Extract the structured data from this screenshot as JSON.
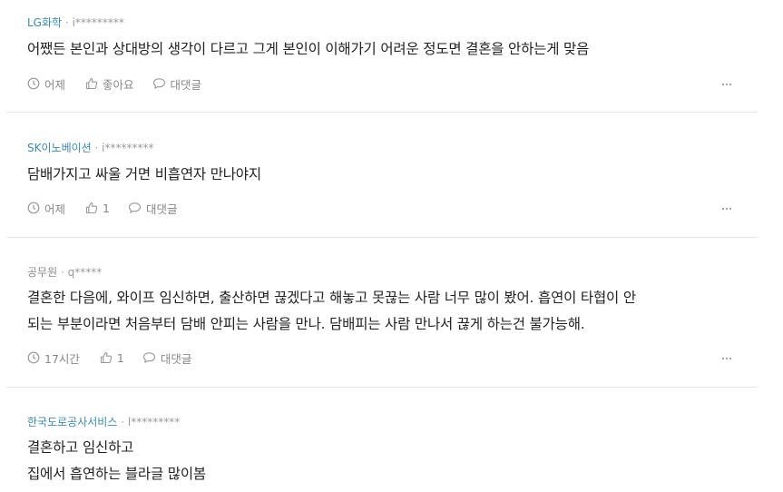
{
  "comments": [
    {
      "company": "LG화학",
      "user": "i*********",
      "lines": [
        "어쨌든 본인과 상대방의 생각이 다르고 그게 본인이 이해가기 어려운 정도면 결혼을 안하는게 맞음"
      ],
      "time": "어제",
      "like": "좋아요",
      "reply": "대댓글"
    },
    {
      "company": "SK이노베이션",
      "user": "i*********",
      "lines": [
        "담배가지고 싸울 거면 비흡연자 만나야지"
      ],
      "time": "어제",
      "like": "1",
      "reply": "대댓글"
    },
    {
      "company": "공무원",
      "user": "q*****",
      "lines": [
        "결혼한 다음에, 와이프 임신하면, 출산하면 끊겠다고 해놓고 못끊는 사람 너무 많이 봤어. 흡연이 타협이 안",
        "되는 부분이라면 처음부터 담배 안피는 사람을 만나. 담배피는 사람 만나서 끊게 하는건 불가능해."
      ],
      "time": "17시간",
      "like": "1",
      "reply": "대댓글"
    },
    {
      "company": "한국도로공사서비스",
      "user": "l*********",
      "lines": [
        "결혼하고 임신하고",
        "집에서 흡연하는 블라글 많이봄"
      ]
    }
  ],
  "separator": "·",
  "colors": {
    "company_link": "#3a8ab0",
    "meta": "#999999",
    "text": "#222222",
    "divider": "#e8e8e8"
  },
  "icons": [
    "clock-icon",
    "thumbs-up-icon",
    "speech-bubble-icon",
    "more-icon"
  ]
}
